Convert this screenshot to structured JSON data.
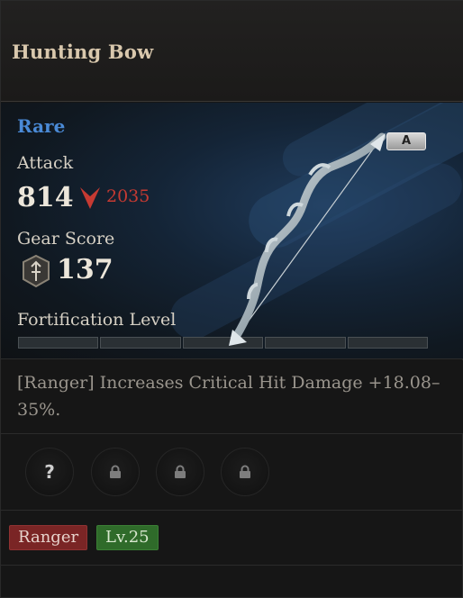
{
  "item": {
    "name": "Hunting Bow",
    "rarity": "Rare",
    "grade": "A",
    "attack_label": "Attack",
    "attack_value": "814",
    "attack_compare_value": "2035",
    "gear_score_label": "Gear Score",
    "gear_score_value": "137",
    "fortification_label": "Fortification Level",
    "fortification_segments": 5,
    "fortification_filled": 0,
    "description": "[Ranger] Increases Critical Hit Damage +18.08–35%.",
    "sockets": [
      {
        "state": "unknown",
        "icon": "question-icon",
        "glyph": "?"
      },
      {
        "state": "locked",
        "icon": "lock-icon"
      },
      {
        "state": "locked",
        "icon": "lock-icon"
      },
      {
        "state": "locked",
        "icon": "lock-icon"
      }
    ],
    "class_tag": "Ranger",
    "level_tag": "Lv.25"
  },
  "colors": {
    "rarity": "#4a8ad6",
    "decrease": "#c63a32",
    "class_tag_bg": "#7a2525",
    "level_tag_bg": "#2f6b2a"
  },
  "icons": {
    "compare": "down-arrow-icon",
    "gear_score": "gear-score-shield-icon",
    "item_art": "bow-icon"
  }
}
